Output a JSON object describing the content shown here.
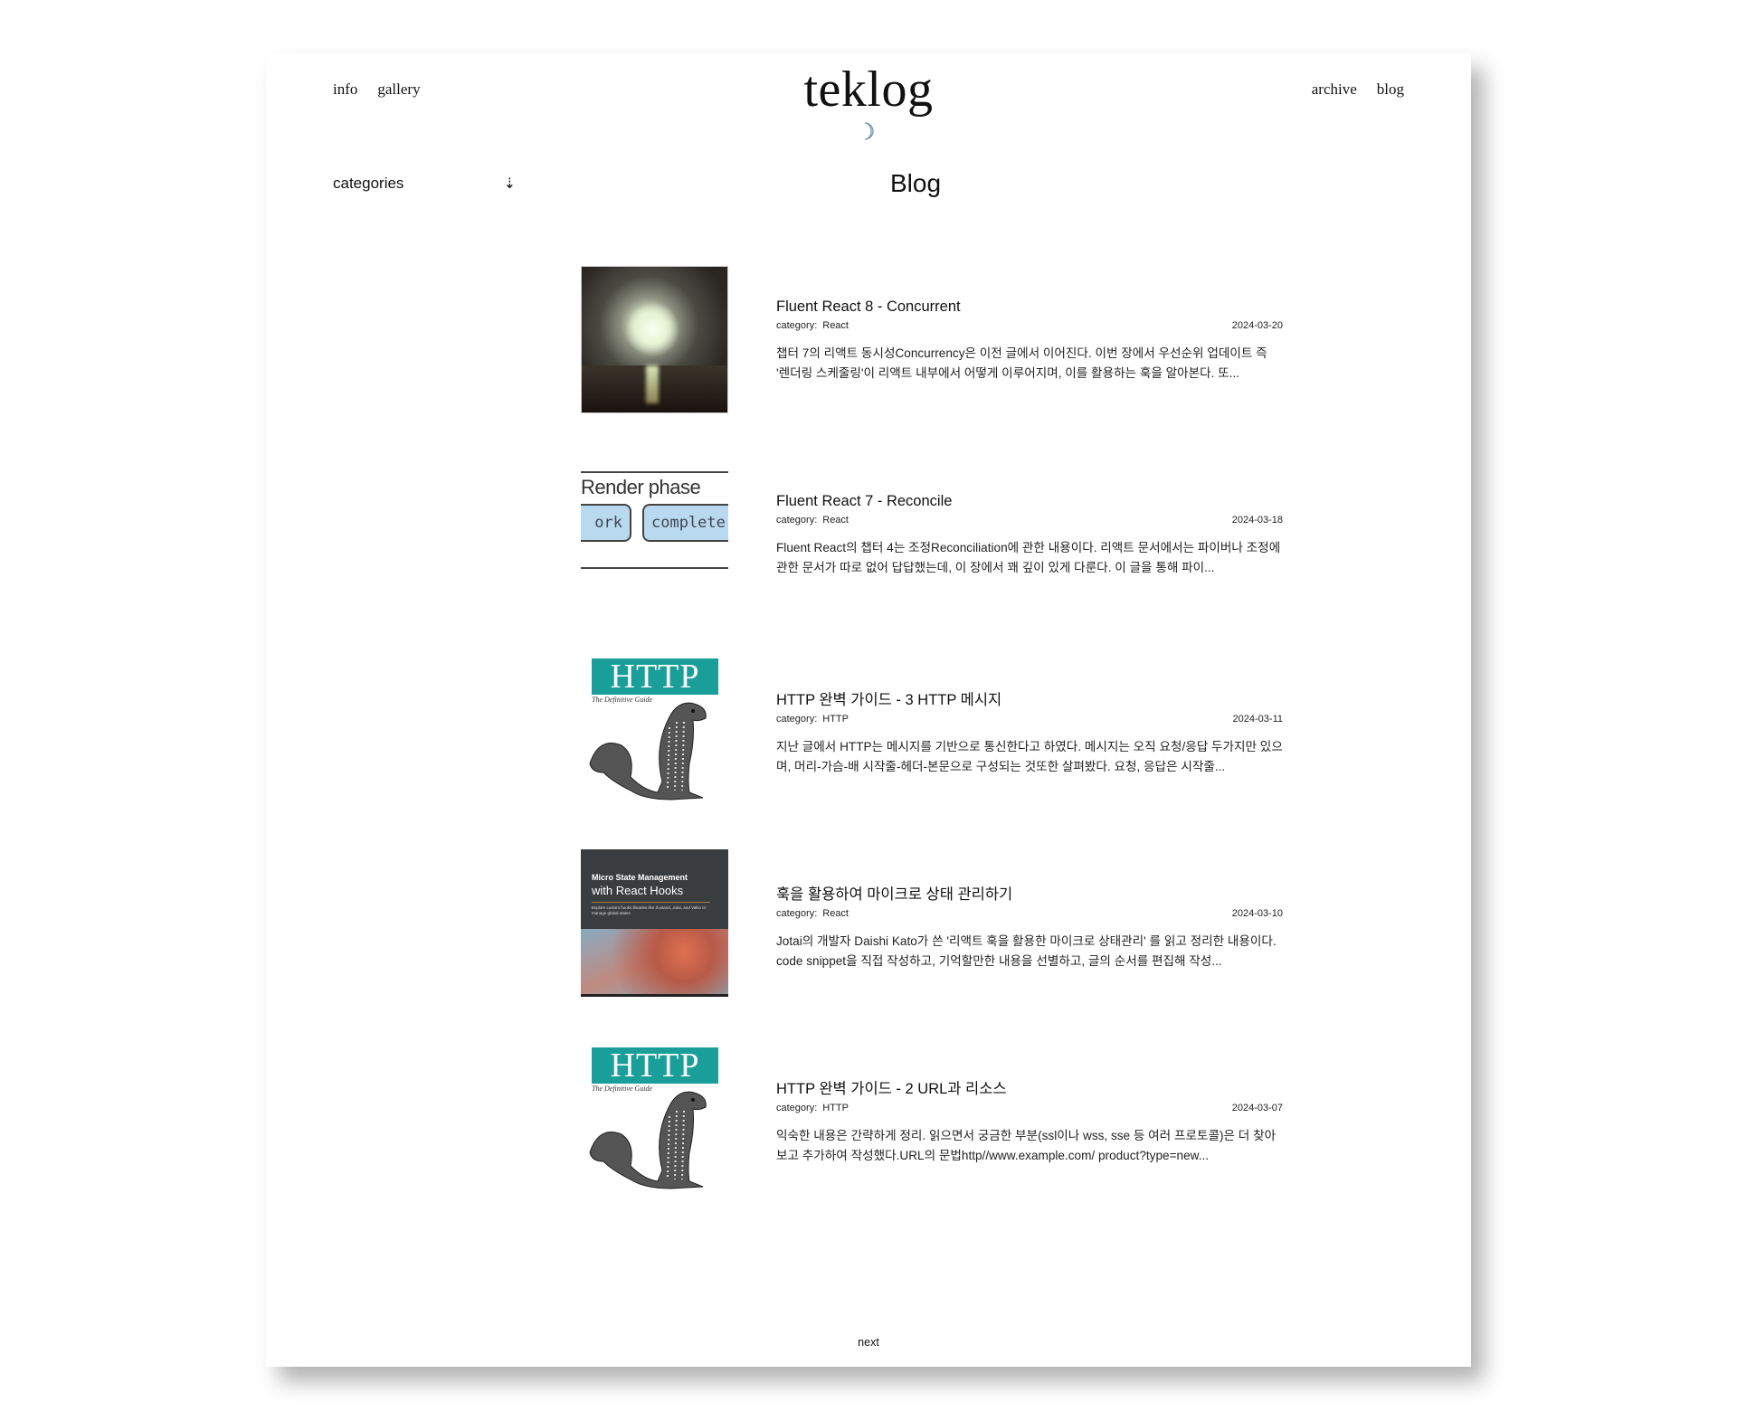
{
  "header": {
    "site_title": "teklog",
    "nav_left": [
      {
        "label": "info"
      },
      {
        "label": "gallery"
      }
    ],
    "nav_right": [
      {
        "label": "archive"
      },
      {
        "label": "blog"
      }
    ],
    "theme_toggle_icon": "moon-icon"
  },
  "sidebar": {
    "label": "categories",
    "toggle_icon": "dotted-arrow-down-icon",
    "toggle_glyph": "⇣"
  },
  "main": {
    "title": "Blog",
    "category_prefix": "category:",
    "posts": [
      {
        "title": "Fluent React 8 - Concurrent",
        "category": "React",
        "date": "2024-03-20",
        "excerpt": "챕터 7의 리액트 동시성Concurrency은 이전 글에서 이어진다. 이번 장에서 우선순위 업데이트 즉 '렌더링 스케줄링'이 리액트 내부에서 어떻게 이루어지며, 이를 활용하는 훅을 알아본다. 또...",
        "thumbnail": "sunset-moon-image"
      },
      {
        "title": "Fluent React 7 - Reconcile",
        "category": "React",
        "date": "2024-03-18",
        "excerpt": "Fluent React의 챕터 4는 조정Reconciliation에 관한 내용이다. 리액트 문서에서는 파이버나 조정에 관한 문서가 따로 없어 답답했는데, 이 장에서 꽤 깊이 있게 다룬다. 이 글을 통해 파이...",
        "thumbnail": "render-phase-diagram",
        "thumb_text": {
          "heading": "Render phase",
          "box1": "ork",
          "box2": "complete"
        }
      },
      {
        "title": "HTTP 완벽 가이드 - 3 HTTP 메시지",
        "category": "HTTP",
        "date": "2024-03-11",
        "excerpt": "지난 글에서 HTTP는 메시지를 기반으로 통신한다고 하였다. 메시지는 오직 요청/응답 두가지만 있으며, 머리-가슴-배 시작줄-헤더-본문으로 구성되는 것또한 살펴봤다. 요청, 응답은 시작줄...",
        "thumbnail": "http-book-cover",
        "thumb_text": {
          "heading": "HTTP",
          "sub": "The Definitive Guide"
        }
      },
      {
        "title": "훅을 활용하여 마이크로 상태 관리하기",
        "category": "React",
        "date": "2024-03-10",
        "excerpt": "Jotai의 개발자 Daishi Kato가 쓴 '리액트 훅을 활용한 마이크로 상태관리' 를 읽고 정리한 내용이다. code snippet을 직접 작성하고, 기억할만한 내용을 선별하고, 글의 순서를 편집해 작성...",
        "thumbnail": "micro-state-book-cover",
        "thumb_text": {
          "heading": "Micro State Management",
          "sub": "with React Hooks",
          "desc": "Explore custom hooks libraries like Zustand, Jotai, and Valtio to manage global states"
        }
      },
      {
        "title": "HTTP 완벽 가이드 - 2 URL과 리소스",
        "category": "HTTP",
        "date": "2024-03-07",
        "excerpt": "익숙한 내용은 간략하게 정리. 읽으면서 궁금한 부분(ssl이나 wss, sse 등 여러 프로토콜)은 더 찾아보고 추가하여 작성했다.URL의 문법http//www.example.com/ product?type=new...",
        "thumbnail": "http-book-cover",
        "thumb_text": {
          "heading": "HTTP",
          "sub": "The Definitive Guide"
        }
      }
    ]
  },
  "pagination": {
    "next_label": "next"
  },
  "colors": {
    "http_teal": "#1a9e9a",
    "render_box": "#b8d9ee",
    "book_dark": "#3a3d3f",
    "moon": "#6a8fb5"
  }
}
